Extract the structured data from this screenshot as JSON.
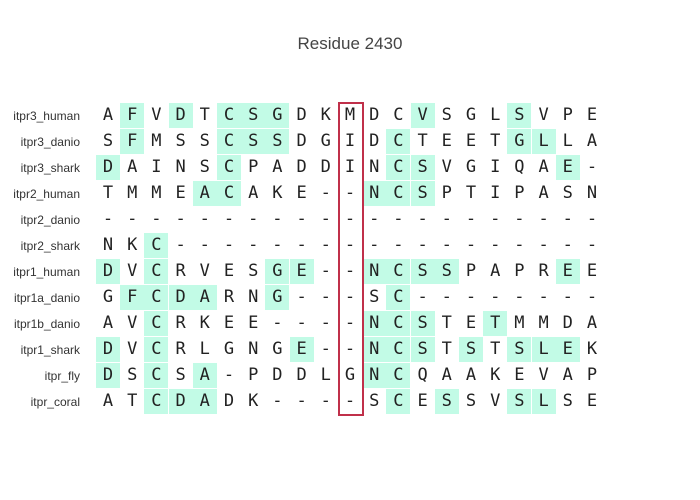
{
  "title": "Residue 2430",
  "highlight_color": "#c2fbe6",
  "focus_box_color": "#c0304a",
  "focus_column": 10,
  "rows": [
    {
      "name": "itpr3_human",
      "seq": "AFVDTCSGDKMDCVSGLSVPE",
      "hl": [
        1,
        3,
        5,
        6,
        7,
        13,
        17
      ]
    },
    {
      "name": "itpr3_danio",
      "seq": "SFMSSCSSDGIDCTEETGLLA",
      "hl": [
        1,
        5,
        6,
        7,
        12,
        17,
        18
      ]
    },
    {
      "name": "itpr3_shark",
      "seq": "DAINSCPADDINCSVGIQAE-",
      "hl": [
        0,
        5,
        12,
        13,
        19
      ]
    },
    {
      "name": "itpr2_human",
      "seq": "TMMEACAKE--NCSPTIPASN",
      "hl": [
        4,
        5,
        11,
        12,
        13
      ]
    },
    {
      "name": "itpr2_danio",
      "seq": "---------------------",
      "hl": []
    },
    {
      "name": "itpr2_shark",
      "seq": "NKC------------------",
      "hl": [
        2
      ]
    },
    {
      "name": "itpr1_human",
      "seq": "DVCRVESGE--NCSSPAPREE",
      "hl": [
        0,
        2,
        7,
        8,
        11,
        12,
        13,
        14,
        19
      ]
    },
    {
      "name": "itpr1a_danio",
      "seq": "GFCDARNG---SC--------",
      "hl": [
        1,
        2,
        3,
        4,
        7,
        12
      ]
    },
    {
      "name": "itpr1b_danio",
      "seq": "AVCRKEE----NCSTETMMDA",
      "hl": [
        2,
        11,
        12,
        13,
        16
      ]
    },
    {
      "name": "itpr1_shark",
      "seq": "DVCRLGNGE--NCSTSTSLEK",
      "hl": [
        0,
        2,
        8,
        11,
        12,
        13,
        15,
        17,
        18,
        19
      ]
    },
    {
      "name": "itpr_fly",
      "seq": "DSCSA-PDDLGNCQAAKEVAP",
      "hl": [
        0,
        2,
        4,
        11,
        12
      ]
    },
    {
      "name": "itpr_coral",
      "seq": "ATCDADK----SCESSVSLSE",
      "hl": [
        2,
        3,
        4,
        12,
        14,
        17,
        18
      ]
    }
  ]
}
